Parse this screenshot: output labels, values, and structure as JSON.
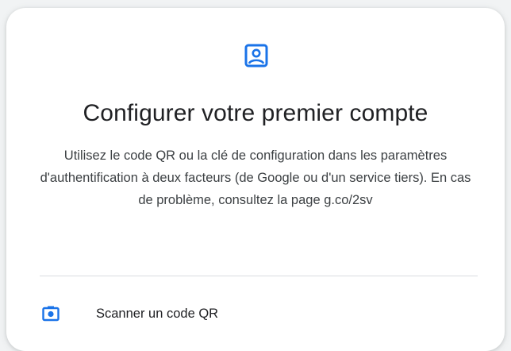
{
  "dialog": {
    "title": "Configurer votre premier compte",
    "description": "Utilisez le code QR ou la clé de configuration dans les paramètres d'authentification à deux facteurs (de Google ou d'un service tiers). En cas de problème, consultez la page g.co/2sv",
    "header_icon": "account-box-icon"
  },
  "actions": [
    {
      "label": "Scanner un code QR",
      "icon": "camera-icon"
    }
  ],
  "colors": {
    "accent": "#1a73e8",
    "title_text": "#202124",
    "body_text": "#3c4043",
    "divider": "#dadce0",
    "background": "#f1f3f4",
    "card": "#ffffff"
  }
}
